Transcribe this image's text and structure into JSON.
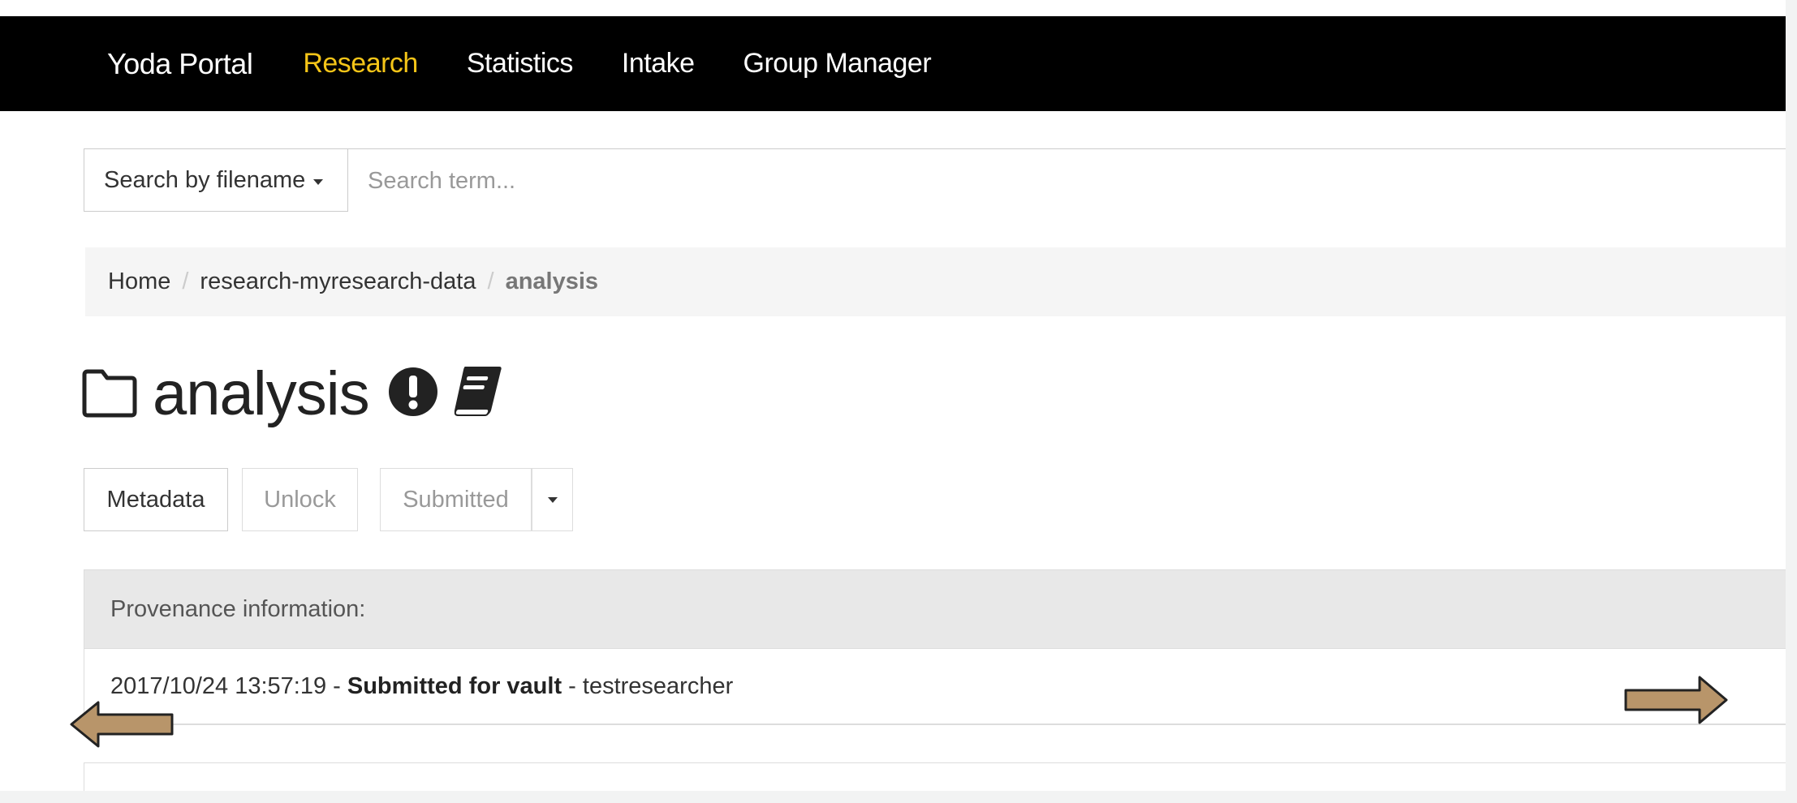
{
  "navbar": {
    "brand": "Yoda Portal",
    "links": [
      {
        "label": "Research",
        "active": true
      },
      {
        "label": "Statistics",
        "active": false
      },
      {
        "label": "Intake",
        "active": false
      },
      {
        "label": "Group Manager",
        "active": false
      }
    ],
    "active_color": "#f5c518",
    "background": "#000000"
  },
  "search": {
    "type_label": "Search by filename",
    "input_value": "",
    "placeholder": "Search term..."
  },
  "breadcrumb": {
    "items": [
      "Home",
      "research-myresearch-data",
      "analysis"
    ],
    "separator": "/"
  },
  "folder": {
    "title": "analysis",
    "icons": [
      "folder-icon",
      "exclamation-circle-icon",
      "book-icon"
    ]
  },
  "actions": {
    "metadata_label": "Metadata",
    "unlock_label": "Unlock",
    "status_label": "Submitted"
  },
  "provenance": {
    "heading": "Provenance information:",
    "entries": [
      {
        "timestamp": "2017/10/24 13:57:19",
        "action": "Submitted for vault",
        "user": "testresearcher"
      }
    ]
  },
  "overlay": {
    "arrows": [
      "arrow-left-icon",
      "arrow-right-icon"
    ],
    "arrow_color": "#b8956a"
  }
}
